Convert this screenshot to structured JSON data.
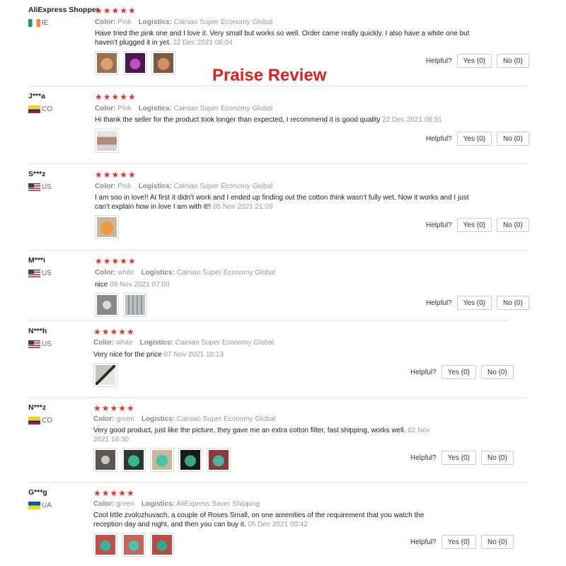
{
  "banner": "Praise Review",
  "stars": "★★★★★",
  "labels": {
    "color": "Color:",
    "logistics": "Logistics:",
    "helpful": "Helpful?"
  },
  "reviews": [
    {
      "user": "AliExpress Shopper",
      "country": "IE",
      "flag": "ie-flag-icon",
      "color": "Pink",
      "logistics": "Cainiao Super Economy Global",
      "text": "Have tried the pink one and I love it. Very small but works so well. Order came really quickly. I also have a white one but haven't plugged it in yet.",
      "date": "22 Dec 2021 06:04",
      "yes": "Yes (0)",
      "no": "No (0)",
      "photos": [
        "#c89a6e",
        "#8a2a8a",
        "#b8865a"
      ]
    },
    {
      "user": "J***a",
      "country": "CO",
      "flag": "co-flag-icon",
      "color": "Pink",
      "logistics": "Cainiao Super Economy Global",
      "text": "Hi thank the seller for the product took longer than expected, I recommend it is good quality",
      "date": "22 Dec 2021 08:51",
      "yes": "Yes (0)",
      "no": "No (0)",
      "photos": [
        "#b08a7a"
      ]
    },
    {
      "user": "S***z",
      "country": "US",
      "flag": "us-flag-icon",
      "color": "Pink",
      "logistics": "Cainiao Super Economy Global",
      "text": "I am soo in love!! At first it didn't work and I ended up finding out the cotton think wasn't fully wet. Now it works and I just can't explain how in love I am with it!!",
      "date": "05 Nov 2021 21:09",
      "yes": "Yes (0)",
      "no": "No (0)",
      "photos": [
        "#e08a3a"
      ]
    },
    {
      "user": "M***i",
      "country": "US",
      "flag": "us-flag-icon",
      "color": "white",
      "logistics": "Cainiao Super Economy Global",
      "text": "nice",
      "date": "09 Nov 2021 07:00",
      "yes": "Yes (0)",
      "no": "No (0)",
      "photos": [
        "#9a9a9a",
        "#a8aeb0"
      ]
    },
    {
      "user": "N***h",
      "country": "US",
      "flag": "us-flag-icon",
      "color": "white",
      "logistics": "Cainiao Super Economy Global",
      "text": "Very nice for the price",
      "date": "07 Nov 2021 10:13",
      "yes": "Yes (0)",
      "no": "No (0)",
      "photos": [
        "#8a8a86"
      ]
    },
    {
      "user": "N***z",
      "country": "CO",
      "flag": "co-flag-icon",
      "color": "green",
      "logistics": "Cainiao Super Economy Global",
      "text": "Very good product, just like the picture, they gave me an extra cotton filter, fast shipping, works well.",
      "date": "02 Nov 2021 16:30",
      "yes": "Yes (0)",
      "no": "No (0)",
      "photos": [
        "#7a7672",
        "#3aa58a",
        "#2fb39a",
        "#3a9a86",
        "#44b59e"
      ]
    },
    {
      "user": "G***g",
      "country": "UA",
      "flag": "ua-flag-icon",
      "color": "green",
      "logistics": "AliExpress Saver Shipping",
      "text": "Cool little zvolozhuvach, a couple of Roses Small, on one amenities of the requirement that you watch the reception day and night, and then you can buy it.",
      "date": "05 Dec 2021 00:42",
      "yes": "Yes (0)",
      "no": "No (0)",
      "photos": [
        "#c0504a",
        "#c8645e",
        "#b84a48"
      ]
    }
  ]
}
